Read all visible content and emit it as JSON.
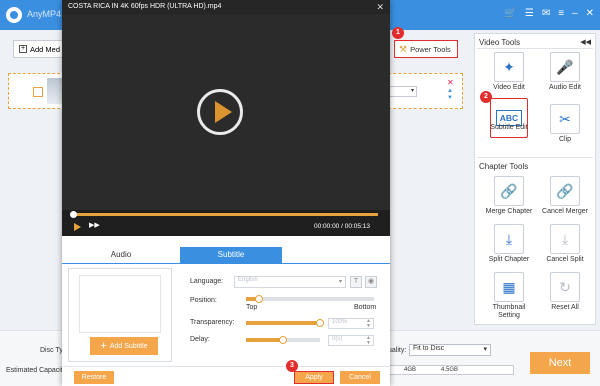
{
  "app": {
    "name": "AnyMP4",
    "icons": [
      "cart-icon",
      "menu-icon",
      "chat-icon",
      "list-icon",
      "minimize-icon",
      "close-icon"
    ]
  },
  "toolbar": {
    "add_media": "Add Med",
    "power_tools": "Power Tools"
  },
  "file_row": {
    "format_value": ""
  },
  "tools_panel": {
    "video_tools_heading": "Video Tools",
    "chapter_tools_heading": "Chapter Tools",
    "video_edit": "Video Edit",
    "audio_edit": "Audio Edit",
    "subtitle_edit": "Subtitle Edit",
    "subtitle_icon_text": "ABC",
    "clip": "Clip",
    "merge_chapter": "Merge Chapter",
    "cancel_merger": "Cancel Merger",
    "split_chapter": "Split Chapter",
    "cancel_split": "Cancel Split",
    "thumbnail_setting": "Thumbnail Setting",
    "reset_all": "Reset All"
  },
  "bottom": {
    "disc_type_label": "Disc Typ",
    "estimated_capacity_label": "Estimated Capacity",
    "quality_label": "uality:",
    "quality_value": "Fit to Disc",
    "cap_mark_4gb": "4GB",
    "cap_mark_45gb": "4.5GB",
    "next": "Next"
  },
  "dialog": {
    "title": "COSTA RICA IN 4K 60fps HDR (ULTRA HD).mp4",
    "timecode": "00:00:00 / 00:05:13",
    "progress_fraction": 0,
    "tabs": {
      "audio": "Audio",
      "subtitle": "Subtitle"
    },
    "add_subtitle": "Add Subtitle",
    "language_label": "Language:",
    "language_value": "English",
    "position_label": "Position:",
    "position_top": "Top",
    "position_bottom": "Bottom",
    "position_value": 0.1,
    "transparency_label": "Transparency:",
    "transparency_value": "100%",
    "transparency_level": 1.0,
    "delay_label": "Delay:",
    "delay_value": "0(s)",
    "delay_level": 0.5,
    "restore": "Restore",
    "apply": "Apply",
    "cancel": "Cancel"
  },
  "badges": {
    "one": "1",
    "two": "2",
    "three": "3"
  },
  "colors": {
    "accent_blue": "#3a8fe0",
    "accent_orange": "#f5a64a",
    "highlight_red": "#e32d2d"
  }
}
